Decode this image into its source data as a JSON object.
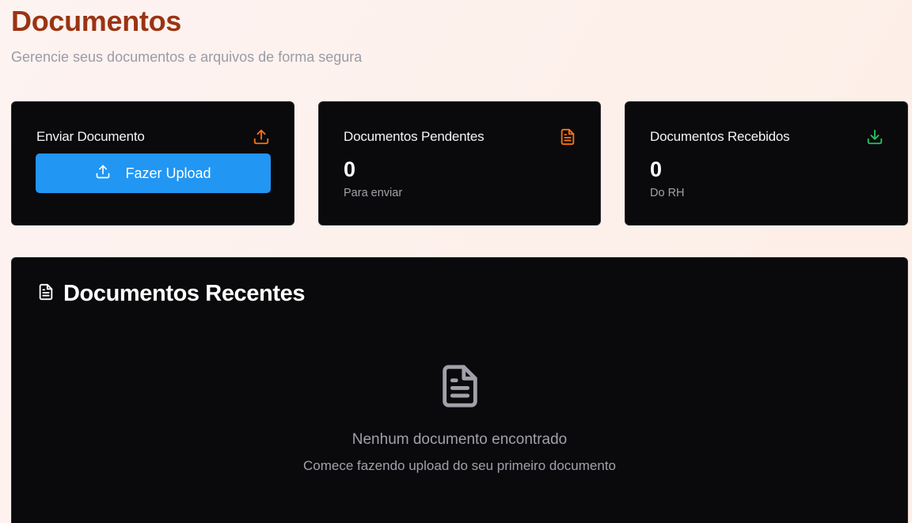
{
  "header": {
    "title": "Documentos",
    "subtitle": "Gerencie seus documentos e arquivos de forma segura"
  },
  "cards": {
    "upload": {
      "title": "Enviar Documento",
      "button_label": "Fazer Upload",
      "icon": "upload-icon"
    },
    "pending": {
      "title": "Documentos Pendentes",
      "value": "0",
      "caption": "Para enviar",
      "icon": "file-text-icon"
    },
    "received": {
      "title": "Documentos Recebidos",
      "value": "0",
      "caption": "Do RH",
      "icon": "download-icon"
    }
  },
  "recent": {
    "title": "Documentos Recentes",
    "icon": "file-text-icon",
    "empty_title": "Nenhum documento encontrado",
    "empty_caption": "Comece fazendo upload do seu primeiro documento"
  },
  "colors": {
    "title": "#9a3412",
    "accent_orange": "#f97316",
    "accent_green": "#22c55e",
    "button_blue": "#2196f3",
    "card_bg": "#0a0a0c"
  }
}
